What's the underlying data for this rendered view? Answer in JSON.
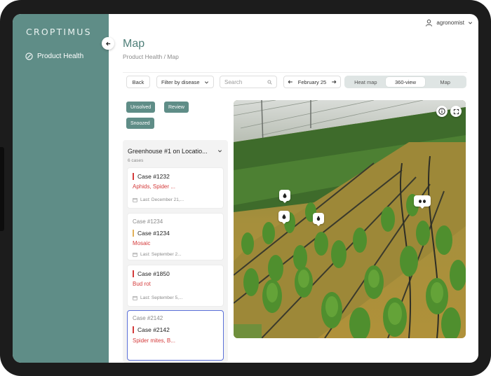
{
  "app": {
    "logo": "CROPTIMUS"
  },
  "sidebar": {
    "items": [
      {
        "label": "Product Health",
        "icon": "leaf-icon"
      }
    ]
  },
  "header": {
    "title": "Map",
    "breadcrumb": "Product Health / Map",
    "user": "agronomist"
  },
  "toolbar": {
    "back_label": "Back",
    "filter_label": "Filter by disease",
    "search_placeholder": "Search",
    "date_label": "February 25",
    "views": [
      {
        "label": "Heat map",
        "active": false
      },
      {
        "label": "360-view",
        "active": true
      },
      {
        "label": "Map",
        "active": false
      }
    ]
  },
  "filters": [
    {
      "label": "Unsolved"
    },
    {
      "label": "Review"
    },
    {
      "label": "Snoozed"
    }
  ],
  "cases_panel": {
    "title": "Greenhouse #1 on Locatio...",
    "count_label": "6 cases",
    "cases": [
      {
        "prefix": "",
        "id": "Case #1232",
        "disease": "Aphids, Spider ...",
        "last": "Last: December 21,...",
        "severity_color": "#d43b3b"
      },
      {
        "prefix": "Case #1234",
        "id": "Case #1234",
        "disease": "Mosaic",
        "last": "Last: September 2...",
        "severity_color": "#e1b05a"
      },
      {
        "prefix": "",
        "id": "Case #1850",
        "disease": "Bud rot",
        "last": "Last: September 5,...",
        "severity_color": "#d43b3b"
      },
      {
        "prefix": "Case #2142",
        "id": "Case #2142",
        "disease": "Spider mites, B...",
        "last": "",
        "severity_color": "#d43b3b"
      }
    ]
  },
  "colors": {
    "accent": "#5f8d87",
    "alert": "#d43b3b",
    "warning": "#e1b05a",
    "selected": "#5a6fd8"
  }
}
